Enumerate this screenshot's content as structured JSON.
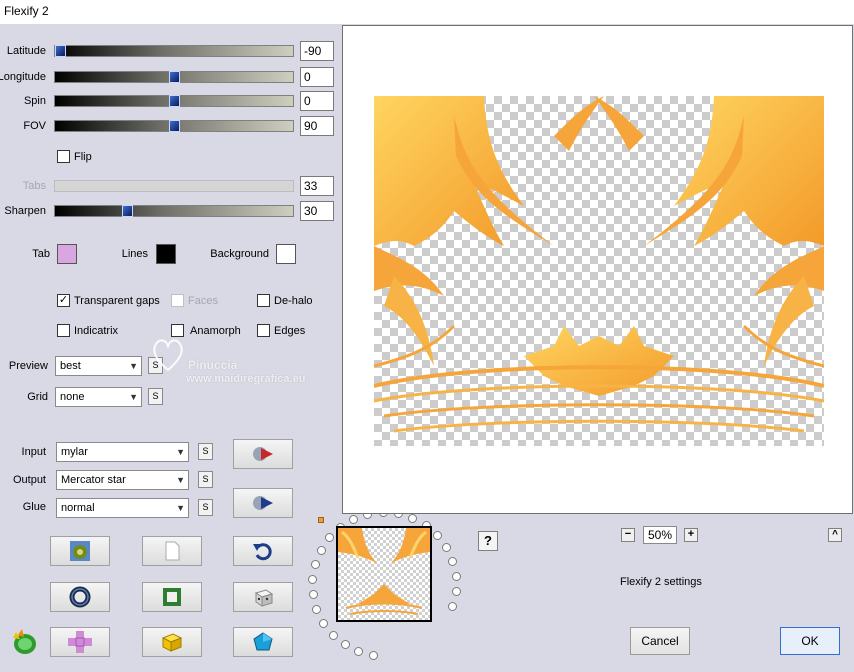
{
  "window": {
    "title": "Flexify 2"
  },
  "sliders": [
    {
      "label": "Latitude",
      "value": "-90",
      "fraction": 0.0,
      "enabled": true
    },
    {
      "label": "Longitude",
      "value": "0",
      "fraction": 0.5,
      "enabled": true
    },
    {
      "label": "Spin",
      "value": "0",
      "fraction": 0.5,
      "enabled": true
    },
    {
      "label": "FOV",
      "value": "90",
      "fraction": 0.5,
      "enabled": true
    }
  ],
  "flip": {
    "label": "Flip",
    "checked": false
  },
  "tabs_slider": {
    "label": "Tabs",
    "value": "33",
    "enabled": false
  },
  "sharpen_slider": {
    "label": "Sharpen",
    "value": "30",
    "fraction": 0.3
  },
  "colors": {
    "tab": {
      "label": "Tab",
      "value": "#d9a6e0"
    },
    "lines": {
      "label": "Lines",
      "value": "#000000"
    },
    "background": {
      "label": "Background",
      "value": "#ffffff"
    }
  },
  "options": {
    "transparent_gaps": {
      "label": "Transparent gaps",
      "checked": true
    },
    "faces": {
      "label": "Faces",
      "checked": false,
      "enabled": false
    },
    "de_halo": {
      "label": "De-halo",
      "checked": false
    },
    "indicatrix": {
      "label": "Indicatrix",
      "checked": false
    },
    "anamorph": {
      "label": "Anamorph",
      "checked": false
    },
    "edges": {
      "label": "Edges",
      "checked": false
    }
  },
  "preview_select": {
    "label": "Preview",
    "value": "best"
  },
  "grid_select": {
    "label": "Grid",
    "value": "none"
  },
  "input_select": {
    "label": "Input",
    "value": "mylar"
  },
  "output_select": {
    "label": "Output",
    "value": "Mercator star"
  },
  "glue_select": {
    "label": "Glue",
    "value": "normal"
  },
  "s_button": "S",
  "watermark": {
    "line1": "Pinuccia",
    "line2": "www.maidiregrafica.eu"
  },
  "zoom": {
    "minus": "−",
    "value": "50%",
    "plus": "+"
  },
  "help": "?",
  "collapse": "^",
  "settings_label": "Flexify 2 settings",
  "buttons": {
    "cancel": "Cancel",
    "ok": "OK"
  },
  "accent": "#f5a623"
}
